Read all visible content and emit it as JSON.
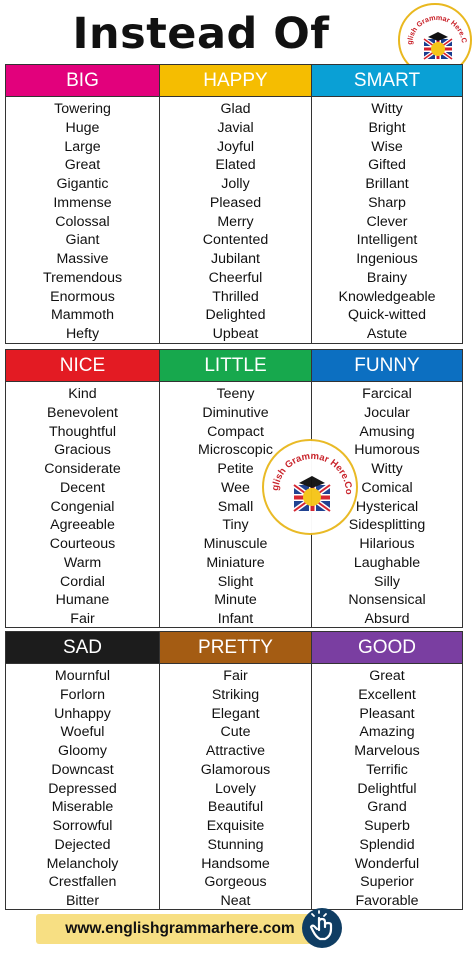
{
  "title": "Instead Of",
  "logo_text": "English Grammar Here.Com",
  "footer": {
    "url": "www.englishgrammarhere.com"
  },
  "sections": [
    [
      {
        "heading": "BIG",
        "color": "#e2017c",
        "words": [
          "Towering",
          "Huge",
          "Large",
          "Great",
          "Gigantic",
          "Immense",
          "Colossal",
          "Giant",
          "Massive",
          "Tremendous",
          "Enormous",
          "Mammoth",
          "Hefty"
        ]
      },
      {
        "heading": "HAPPY",
        "color": "#f5bd01",
        "words": [
          "Glad",
          "Javial",
          "Joyful",
          "Elated",
          "Jolly",
          "Pleased",
          "Merry",
          "Contented",
          "Jubilant",
          "Cheerful",
          "Thrilled",
          "Delighted",
          "Upbeat"
        ]
      },
      {
        "heading": "SMART",
        "color": "#0aa0d5",
        "words": [
          "Witty",
          "Bright",
          "Wise",
          "Gifted",
          "Brillant",
          "Sharp",
          "Clever",
          "Intelligent",
          "Ingenious",
          "Brainy",
          "Knowledgeable",
          "Quick-witted",
          "Astute"
        ]
      }
    ],
    [
      {
        "heading": "NICE",
        "color": "#e31b23",
        "words": [
          "Kind",
          "Benevolent",
          "Thoughtful",
          "Gracious",
          "Considerate",
          "Decent",
          "Congenial",
          "Agreeable",
          "Courteous",
          "Warm",
          "Cordial",
          "Humane",
          "Fair"
        ]
      },
      {
        "heading": "LITTLE",
        "color": "#17a84d",
        "words": [
          "Teeny",
          "Diminutive",
          "Compact",
          "Microscopic",
          "Petite",
          "Wee",
          "Small",
          "Tiny",
          "Minuscule",
          "Miniature",
          "Slight",
          "Minute",
          "Infant"
        ]
      },
      {
        "heading": "FUNNY",
        "color": "#0c6fc1",
        "words": [
          "Farcical",
          "Jocular",
          "Amusing",
          "Humorous",
          "Witty",
          "Comical",
          "Hysterical",
          "Sidesplitting",
          "Hilarious",
          "Laughable",
          "Silly",
          "Nonsensical",
          "Absurd"
        ]
      }
    ],
    [
      {
        "heading": "SAD",
        "color": "#1c1c1c",
        "words": [
          "Mournful",
          "Forlorn",
          "Unhappy",
          "Woeful",
          "Gloomy",
          "Downcast",
          "Depressed",
          "Miserable",
          "Sorrowful",
          "Dejected",
          "Melancholy",
          "Crestfallen",
          "Bitter"
        ]
      },
      {
        "heading": "PRETTY",
        "color": "#a45c13",
        "words": [
          "Fair",
          "Striking",
          "Elegant",
          "Cute",
          "Attractive",
          "Glamorous",
          "Lovely",
          "Beautiful",
          "Exquisite",
          "Stunning",
          "Handsome",
          "Gorgeous",
          "Neat"
        ]
      },
      {
        "heading": "GOOD",
        "color": "#7a3ea1",
        "words": [
          "Great",
          "Excellent",
          "Pleasant",
          "Amazing",
          "Marvelous",
          "Terrific",
          "Delightful",
          "Grand",
          "Superb",
          "Splendid",
          "Wonderful",
          "Superior",
          "Favorable"
        ]
      }
    ]
  ]
}
